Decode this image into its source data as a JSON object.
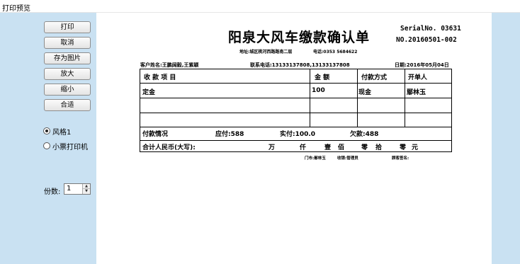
{
  "window": {
    "title": "打印预览"
  },
  "buttons": {
    "print": "打印",
    "cancel": "取消",
    "save_image": "存为图片",
    "zoom_in": "放大",
    "zoom_out": "缩小",
    "fit": "合适"
  },
  "styles": {
    "style1": "风格1",
    "small_printer": "小票打印机",
    "selected": "style1"
  },
  "copies": {
    "label": "份数:",
    "value": "1"
  },
  "doc": {
    "title": "阳泉大风车缴款确认单",
    "serial": "SerialNo. 03631",
    "no": "NO.20160501-002",
    "address": "地址:城区桃河西路路南二层",
    "phone": "电话:0353 5684622",
    "customer": "客户姓名:王鹏阔毅,王紫颖",
    "contact": "联系电话:13133137808,13133137808",
    "date": "日期:2016年05月04日",
    "table": {
      "headers": {
        "item": "收 款 项 目",
        "amount": "金   额",
        "payment": "付款方式",
        "issuer": "开单人"
      },
      "row1": {
        "item": "定金",
        "amount": "100",
        "payment": "现金",
        "issuer": "鄢林玉"
      },
      "summary": {
        "label": "付款情况",
        "due": "应付:588",
        "paid": "实付:100.0",
        "owed": "欠款:488"
      },
      "rmb": {
        "label": "合计人民币(大写):",
        "wan": "万",
        "qian": "仟",
        "bai_digit": "壹",
        "bai": "佰",
        "shi_digit": "零",
        "shi": "拾",
        "yuan_digit": "零",
        "yuan": "元"
      }
    },
    "footer": {
      "store": "门市:鄢林玉",
      "cashier": "收银:管理员",
      "customer_sign": "顾客签名:"
    }
  }
}
